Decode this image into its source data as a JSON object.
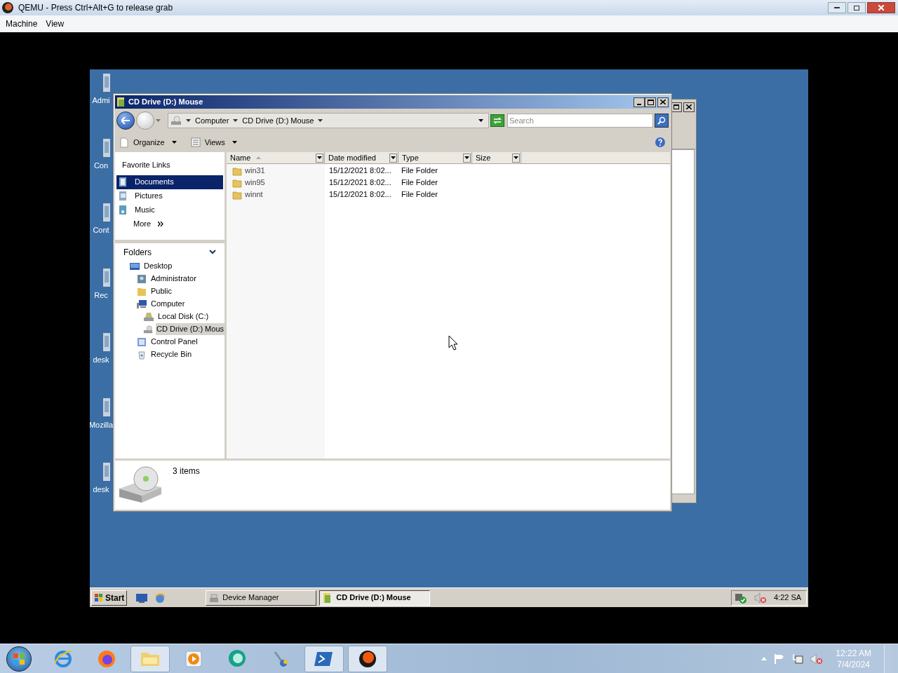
{
  "host": {
    "title": "QEMU - Press Ctrl+Alt+G to release grab",
    "menu": [
      "Machine",
      "View"
    ]
  },
  "guest": {
    "desktop_icons": [
      {
        "label": "Admi"
      },
      {
        "label": "Con"
      },
      {
        "label": "Cont"
      },
      {
        "label": "Rec"
      },
      {
        "label": "desk"
      },
      {
        "label": "Mozilla"
      },
      {
        "label": "desk"
      }
    ],
    "explorer": {
      "title": "CD Drive (D:) Mouse",
      "breadcrumb": [
        "Computer",
        "CD Drive (D:) Mouse"
      ],
      "search": {
        "placeholder": "Search"
      },
      "toolbar": [
        "Organize",
        "Views"
      ],
      "favorites_title": "Favorite Links",
      "favorites": [
        {
          "label": "Documents",
          "kind": "documents",
          "selected": true
        },
        {
          "label": "Pictures",
          "kind": "pictures",
          "selected": false
        },
        {
          "label": "Music",
          "kind": "music",
          "selected": false
        }
      ],
      "more": "More",
      "folders_title": "Folders",
      "tree": [
        {
          "label": "Desktop",
          "kind": "desktop",
          "selected": false,
          "children": [
            {
              "label": "Administrator",
              "kind": "user",
              "selected": false
            },
            {
              "label": "Public",
              "kind": "folder",
              "selected": false
            },
            {
              "label": "Computer",
              "kind": "computer",
              "selected": false,
              "children": [
                {
                  "label": "Local Disk (C:)",
                  "kind": "disk",
                  "selected": false
                },
                {
                  "label": "CD Drive (D:) Mous",
                  "kind": "cd",
                  "selected": true
                }
              ]
            },
            {
              "label": "Control Panel",
              "kind": "control",
              "selected": false
            },
            {
              "label": "Recycle Bin",
              "kind": "recycle",
              "selected": false
            }
          ]
        }
      ],
      "columns": [
        "Name",
        "Date modified",
        "Type",
        "Size"
      ],
      "rows": [
        {
          "name": "win31",
          "date": "15/12/2021 8:02...",
          "type": "File Folder"
        },
        {
          "name": "win95",
          "date": "15/12/2021 8:02...",
          "type": "File Folder"
        },
        {
          "name": "winnt",
          "date": "15/12/2021 8:02...",
          "type": "File Folder"
        }
      ],
      "status": "3 items"
    },
    "taskbar": {
      "start": "Start",
      "tasks": [
        {
          "label": "Device Manager",
          "kind": "devmgr",
          "selected": false
        },
        {
          "label": "CD Drive (D:) Mouse",
          "kind": "explorer",
          "selected": true
        }
      ],
      "clock": "4:22 SA"
    }
  },
  "host_taskbar": {
    "apps": [
      {
        "kind": "ie",
        "running": false
      },
      {
        "kind": "firefox",
        "running": false
      },
      {
        "kind": "explorer",
        "running": true
      },
      {
        "kind": "media",
        "running": false
      },
      {
        "kind": "chat",
        "running": false
      },
      {
        "kind": "vs",
        "running": false
      },
      {
        "kind": "powershell",
        "running": true
      },
      {
        "kind": "qemu",
        "running": true
      }
    ],
    "time": "12:22 AM",
    "date": "7/4/2024"
  }
}
